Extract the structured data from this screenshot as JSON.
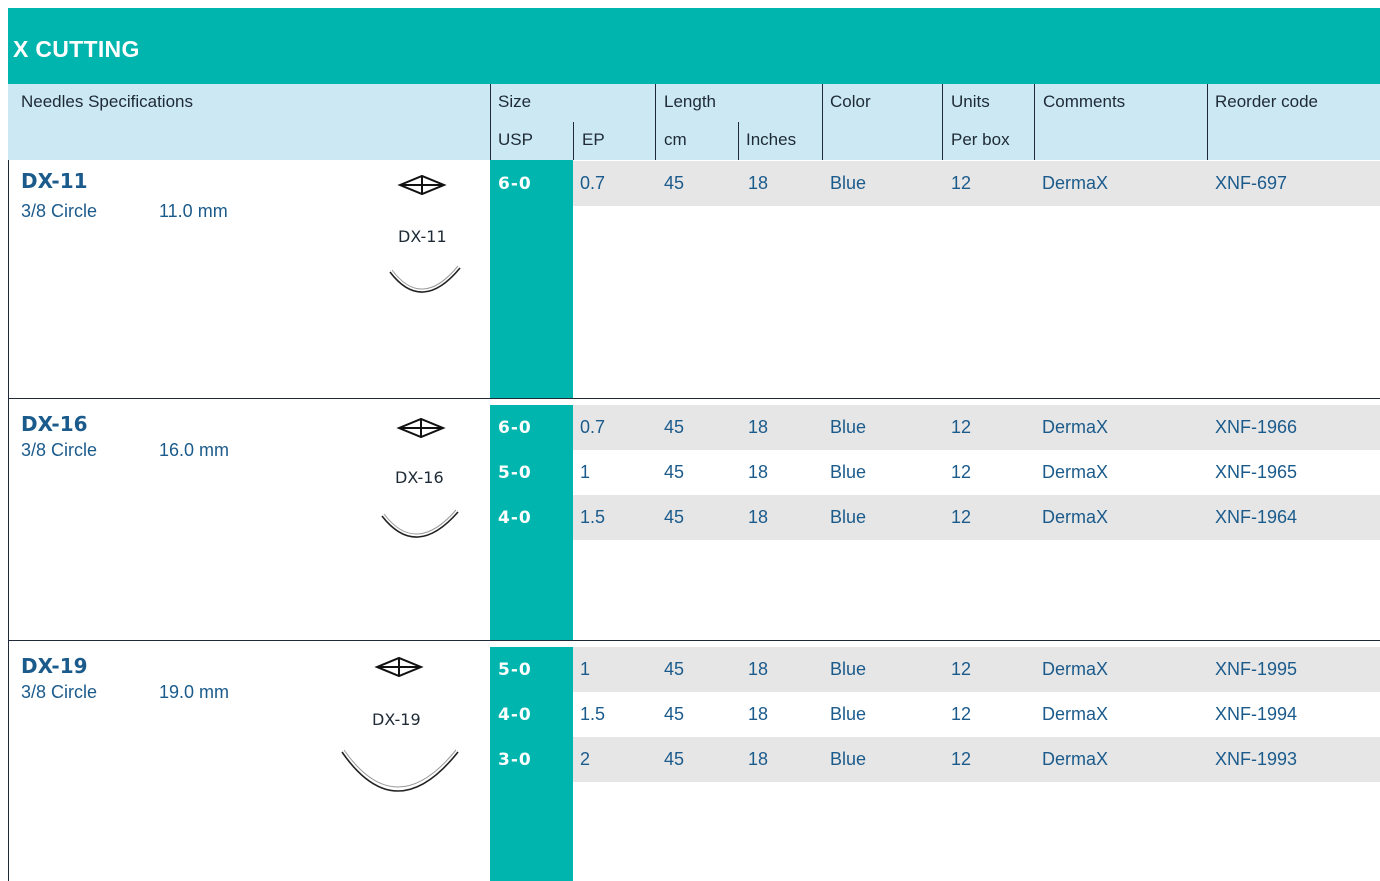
{
  "title": "X CUTTING",
  "header": {
    "needles_spec": "Needles Specifications",
    "size": "Size",
    "usp": "USP",
    "ep": "EP",
    "length": "Length",
    "cm": "cm",
    "inches": "Inches",
    "color": "Color",
    "units": "Units",
    "per_box": "Per box",
    "comments": "Comments",
    "reorder_code": "Reorder code"
  },
  "colors": {
    "teal": "#00b5ad",
    "header_bg": "#cbe8f3",
    "text_blue": "#1b5b8c",
    "row_gray": "#e6e6e6"
  },
  "groups": [
    {
      "name": "DX-11",
      "circle": "3/8 Circle",
      "length": "11.0 mm",
      "label": "DX-11",
      "rows": [
        {
          "usp": "6-0",
          "ep": "0.7",
          "cm": "45",
          "inches": "18",
          "color": "Blue",
          "units": "12",
          "comment": "DermaX",
          "code": "XNF-697"
        }
      ]
    },
    {
      "name": "DX-16",
      "circle": "3/8 Circle",
      "length": "16.0 mm",
      "label": "DX-16",
      "rows": [
        {
          "usp": "6-0",
          "ep": "0.7",
          "cm": "45",
          "inches": "18",
          "color": "Blue",
          "units": "12",
          "comment": "DermaX",
          "code": "XNF-1966"
        },
        {
          "usp": "5-0",
          "ep": "1",
          "cm": "45",
          "inches": "18",
          "color": "Blue",
          "units": "12",
          "comment": "DermaX",
          "code": "XNF-1965"
        },
        {
          "usp": "4-0",
          "ep": "1.5",
          "cm": "45",
          "inches": "18",
          "color": "Blue",
          "units": "12",
          "comment": "DermaX",
          "code": "XNF-1964"
        }
      ]
    },
    {
      "name": "DX-19",
      "circle": "3/8 Circle",
      "length": "19.0 mm",
      "label": "DX-19",
      "rows": [
        {
          "usp": "5-0",
          "ep": "1",
          "cm": "45",
          "inches": "18",
          "color": "Blue",
          "units": "12",
          "comment": "DermaX",
          "code": "XNF-1995"
        },
        {
          "usp": "4-0",
          "ep": "1.5",
          "cm": "45",
          "inches": "18",
          "color": "Blue",
          "units": "12",
          "comment": "DermaX",
          "code": "XNF-1994"
        },
        {
          "usp": "3-0",
          "ep": "2",
          "cm": "45",
          "inches": "18",
          "color": "Blue",
          "units": "12",
          "comment": "DermaX",
          "code": "XNF-1993"
        }
      ]
    }
  ]
}
